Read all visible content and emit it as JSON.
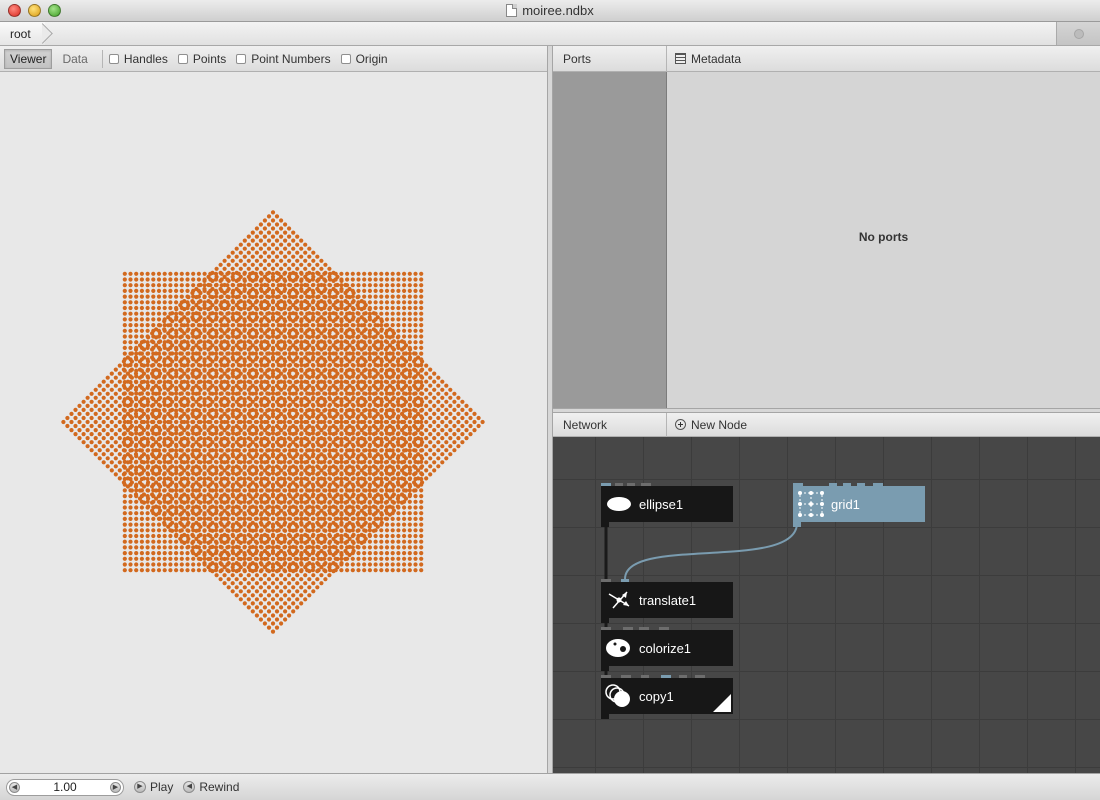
{
  "window": {
    "title": "moiree.ndbx"
  },
  "addressbar": {
    "crumb": "root"
  },
  "viewer": {
    "tabs": [
      "Viewer",
      "Data"
    ],
    "checkboxes": [
      "Handles",
      "Points",
      "Point Numbers",
      "Origin"
    ],
    "dot_color": "#d2691e"
  },
  "ports_pane": {
    "ports_label": "Ports",
    "metadata_label": "Metadata",
    "empty_message": "No ports"
  },
  "network_pane": {
    "network_label": "Network",
    "new_node_label": "New Node",
    "nodes": {
      "ellipse": "ellipse1",
      "grid": "grid1",
      "translate": "translate1",
      "colorize": "colorize1",
      "copy": "copy1"
    },
    "selected_color": "#7a9cb0"
  },
  "bottombar": {
    "frame": "1.00",
    "play": "Play",
    "rewind": "Rewind"
  }
}
